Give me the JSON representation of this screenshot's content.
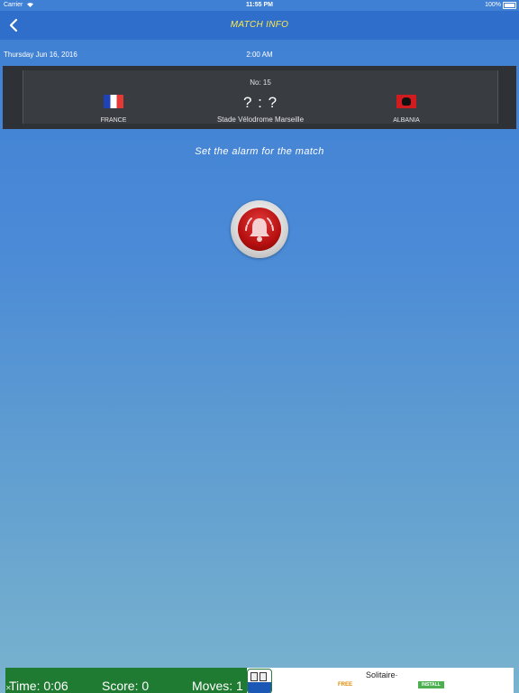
{
  "status_bar": {
    "carrier": "Carrier",
    "time": "11:55 PM",
    "battery": "100%"
  },
  "nav": {
    "back_icon": "chevron-left-icon",
    "title": "MATCH INFO"
  },
  "match": {
    "date": "Thursday Jun 16, 2016",
    "time": "2:00 AM",
    "number": "No: 15",
    "score": "? : ?",
    "stadium": "Stade Vélodrome Marseille",
    "home_team": "FRANCE",
    "away_team": "ALBANIA"
  },
  "alarm": {
    "prompt": "Set the alarm for the match",
    "icon": "bell-icon"
  },
  "ad": {
    "time": "Time: 0:06",
    "score": "Score: 0",
    "moves": "Moves: 1",
    "title": "Solitaire·",
    "free": "FREE",
    "install": "INSTALL",
    "close": "✕"
  },
  "colors": {
    "nav_bg": "#2f6fcb",
    "nav_title": "#ffe84a",
    "card_bg": "#393c41",
    "alarm_red": "#b71010"
  }
}
